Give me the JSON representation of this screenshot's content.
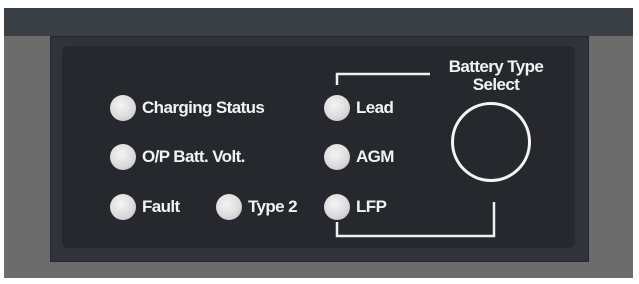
{
  "indicators": {
    "charging_status": "Charging Status",
    "op_batt_volt": "O/P Batt. Volt.",
    "fault": "Fault",
    "type2": "Type 2"
  },
  "battery_types": {
    "lead": "Lead",
    "agm": "AGM",
    "lfp": "LFP"
  },
  "selector": {
    "title_line1": "Battery Type",
    "title_line2": "Select"
  },
  "colors": {
    "panel": "#26282d",
    "led": "#dcdcdc",
    "text": "#f2f2f2",
    "enclosure": "#6c6c6c",
    "top_bar": "#3a4046"
  },
  "icons": [
    "led-indicator",
    "select-button-ring",
    "bracket-line"
  ]
}
